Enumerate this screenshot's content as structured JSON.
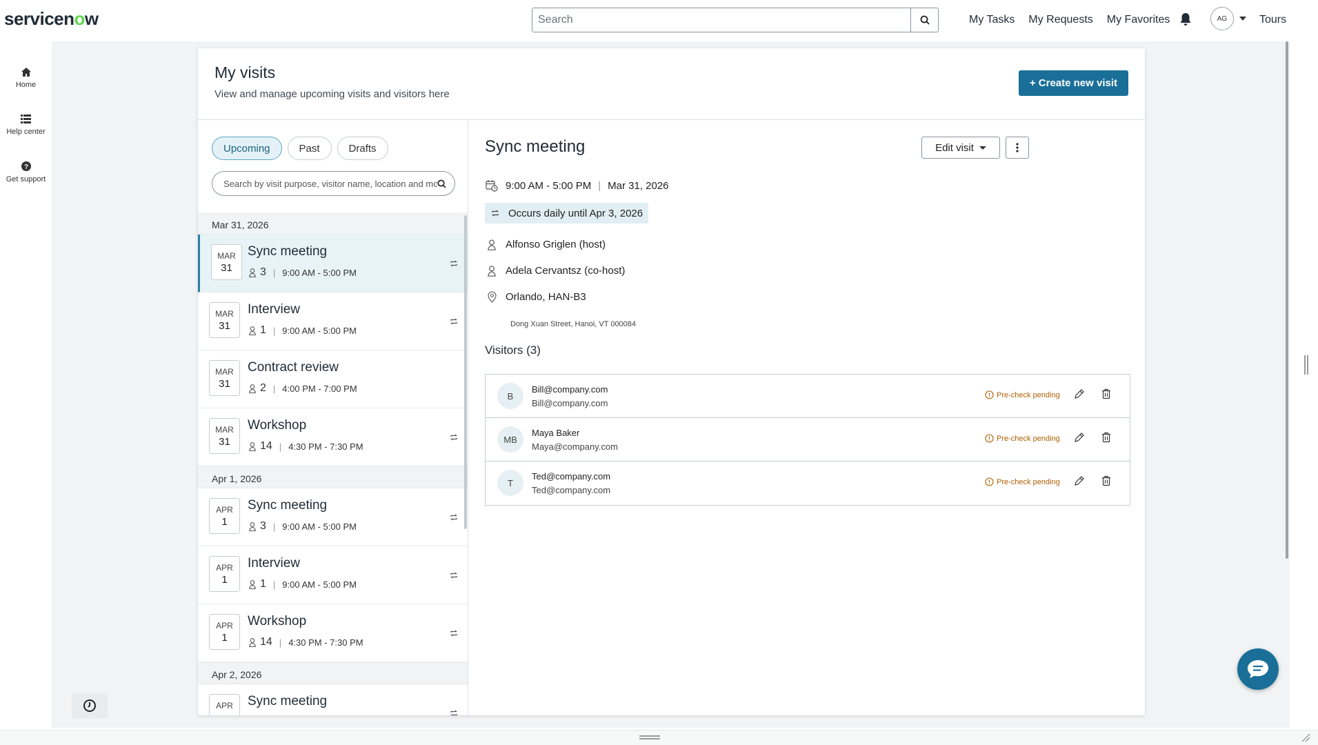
{
  "header": {
    "logo": "servicenow",
    "search_placeholder": "Search",
    "links": [
      "My Tasks",
      "My Requests",
      "My Favorites"
    ],
    "avatar_initials": "AG",
    "tours": "Tours"
  },
  "rail": {
    "items": [
      {
        "label": "Home",
        "icon": "home-icon"
      },
      {
        "label": "Help center",
        "icon": "list-icon"
      },
      {
        "label": "Get support",
        "icon": "help-icon"
      }
    ]
  },
  "page": {
    "title": "My visits",
    "subtitle": "View and manage upcoming visits and visitors here",
    "create_button": "+ Create new visit"
  },
  "tabs": [
    "Upcoming",
    "Past",
    "Drafts"
  ],
  "list_search_placeholder": "Search by visit purpose, visitor name, location and more",
  "groups": [
    {
      "date": "Mar 31, 2026",
      "visits": [
        {
          "mon": "MAR",
          "day": "31",
          "title": "Sync meeting",
          "count": "3",
          "time": "9:00 AM - 5:00 PM",
          "recurring": true
        },
        {
          "mon": "MAR",
          "day": "31",
          "title": "Interview",
          "count": "1",
          "time": "9:00 AM - 5:00 PM",
          "recurring": true
        },
        {
          "mon": "MAR",
          "day": "31",
          "title": "Contract review",
          "count": "2",
          "time": "4:00 PM - 7:00 PM",
          "recurring": false
        },
        {
          "mon": "MAR",
          "day": "31",
          "title": "Workshop",
          "count": "14",
          "time": "4:30 PM - 7:30 PM",
          "recurring": true
        }
      ]
    },
    {
      "date": "Apr 1, 2026",
      "visits": [
        {
          "mon": "APR",
          "day": "1",
          "title": "Sync meeting",
          "count": "3",
          "time": "9:00 AM - 5:00 PM",
          "recurring": true
        },
        {
          "mon": "APR",
          "day": "1",
          "title": "Interview",
          "count": "1",
          "time": "9:00 AM - 5:00 PM",
          "recurring": true
        },
        {
          "mon": "APR",
          "day": "1",
          "title": "Workshop",
          "count": "14",
          "time": "4:30 PM - 7:30 PM",
          "recurring": true
        }
      ]
    },
    {
      "date": "Apr 2, 2026",
      "visits": [
        {
          "mon": "APR",
          "day": "",
          "title": "Sync meeting",
          "count": "",
          "time": "",
          "recurring": true
        }
      ]
    }
  ],
  "detail": {
    "title": "Sync meeting",
    "edit_button": "Edit visit",
    "time": "9:00 AM - 5:00 PM",
    "date": "Mar 31, 2026",
    "recurrence": "Occurs daily until Apr 3, 2026",
    "host": "Alfonso Griglen (host)",
    "cohost": "Adela Cervantsz (co-host)",
    "location": "Orlando, HAN-B3",
    "address": "Dong Xuan Street, Hanoi, VT 000084",
    "visitors_title": "Visitors (3)",
    "visitors": [
      {
        "initials": "B",
        "name": "Bill@company.com",
        "email": "Bill@company.com",
        "status": "Pre-check pending"
      },
      {
        "initials": "MB",
        "name": "Maya Baker",
        "email": "Maya@company.com",
        "status": "Pre-check pending"
      },
      {
        "initials": "T",
        "name": "Ted@company.com",
        "email": "Ted@company.com",
        "status": "Pre-check pending"
      }
    ]
  },
  "colors": {
    "brand": "#1a6f98",
    "logo_accent": "#62d84e",
    "selected_row": "#e8f3f7",
    "warning": "#b05e00"
  }
}
